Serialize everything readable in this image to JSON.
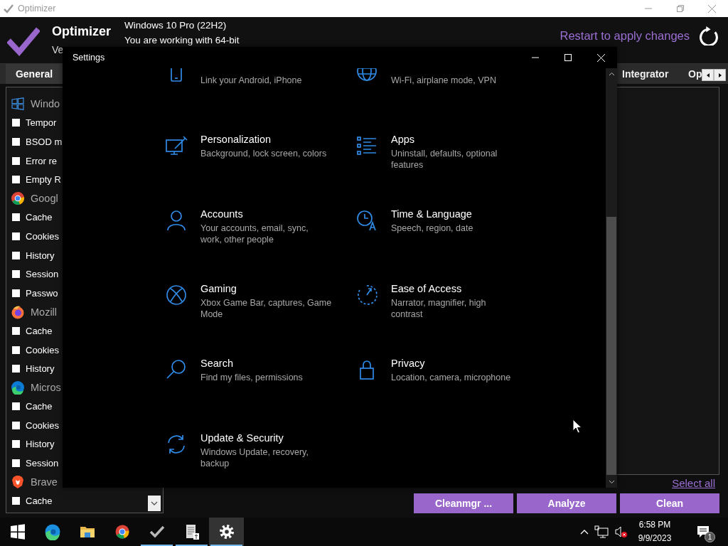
{
  "title_bar": {
    "title": "Optimizer"
  },
  "header": {
    "app_name": "Optimizer",
    "version": "Ve",
    "os": "Windows 10 Pro (22H2)",
    "arch": "You are working with 64-bit",
    "restart_link": "Restart to apply changes"
  },
  "tabs": [
    {
      "label": "General",
      "selected": true
    },
    {
      "label": "Integrator",
      "selected": false
    },
    {
      "label": "Op",
      "selected": false
    }
  ],
  "groups": [
    {
      "title": "Windo",
      "items": [
        {
          "label": "Tempor",
          "checked": false
        },
        {
          "label": "BSOD m",
          "checked": false
        },
        {
          "label": "Error re",
          "checked": false
        },
        {
          "label": "Empty R",
          "checked": false
        }
      ]
    },
    {
      "title": "Googl",
      "items": [
        {
          "label": "Cache",
          "checked": false
        },
        {
          "label": "Cookies",
          "checked": false
        },
        {
          "label": "History",
          "checked": false
        },
        {
          "label": "Session",
          "checked": false
        },
        {
          "label": "Passwo",
          "checked": false
        }
      ]
    },
    {
      "title": "Mozill",
      "items": [
        {
          "label": "Cache",
          "checked": false
        },
        {
          "label": "Cookies",
          "checked": false
        },
        {
          "label": "History",
          "checked": false
        }
      ]
    },
    {
      "title": "Micros",
      "items": [
        {
          "label": "Cache",
          "checked": false
        },
        {
          "label": "Cookies",
          "checked": false
        },
        {
          "label": "History",
          "checked": false
        },
        {
          "label": "Session",
          "checked": false
        }
      ]
    },
    {
      "title": "Brave",
      "items": [
        {
          "label": "Cache",
          "checked": false
        }
      ]
    }
  ],
  "select_all": "Select all",
  "buttons": [
    "Cleanmgr ...",
    "Analyze",
    "Clean"
  ],
  "settings": {
    "title": "Settings",
    "tiles": [
      {
        "description": "Link your Android, iPhone"
      },
      {
        "description": "Wi-Fi, airplane mode, VPN"
      },
      {
        "title": "Personalization",
        "description": "Background, lock screen, colors"
      },
      {
        "title": "Apps",
        "description": "Uninstall, defaults, optional\nfeatures"
      },
      {
        "title": "Accounts",
        "description": "Your accounts, email, sync,\nwork, other people"
      },
      {
        "title": "Time & Language",
        "description": "Speech, region, date"
      },
      {
        "title": "Gaming",
        "description": "Xbox Game Bar, captures, Game\nMode"
      },
      {
        "title": "Ease of Access",
        "description": "Narrator, magnifier, high\ncontrast"
      },
      {
        "title": "Search",
        "description": "Find my files, permissions"
      },
      {
        "title": "Privacy",
        "description": "Location, camera, microphone"
      },
      {
        "title": "Update & Security",
        "description": "Windows Update, recovery,\nbackup"
      }
    ]
  },
  "taskbar": {
    "apps": [
      {
        "running": false,
        "selected": false
      },
      {
        "running": false,
        "selected": false
      },
      {
        "running": false,
        "selected": false
      },
      {
        "running": false,
        "selected": false
      },
      {
        "running": true,
        "selected": false
      },
      {
        "running": true,
        "selected": false
      },
      {
        "running": true,
        "selected": true
      }
    ],
    "time": "6:58 PM",
    "date": "9/9/2023",
    "notification_count": "1"
  }
}
